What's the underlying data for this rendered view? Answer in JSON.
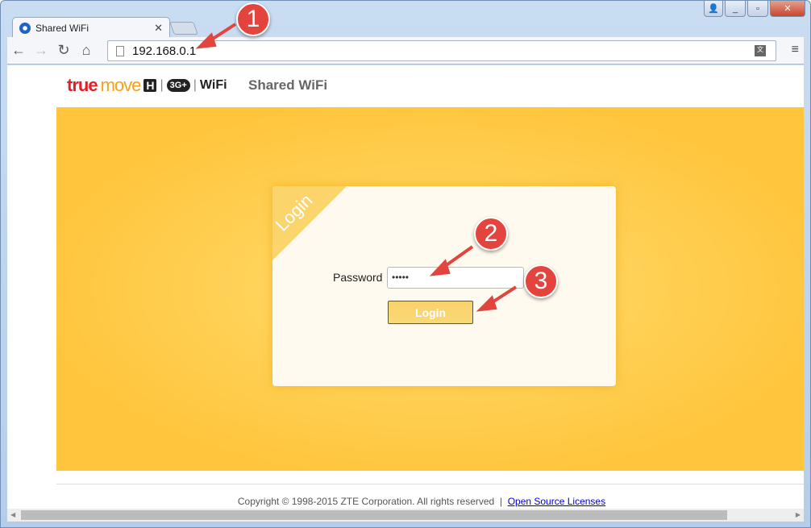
{
  "browser": {
    "tab_title": "Shared WiFi",
    "url": "192.168.0.1"
  },
  "header": {
    "logo_text": "truemove H 3G+ WiFi",
    "logo_true": "true",
    "logo_move": "move",
    "logo_h": "H",
    "logo_3g": "3G+",
    "logo_wifi": "WiFi",
    "title": "Shared WiFi"
  },
  "login": {
    "corner_label": "Login",
    "password_label": "Password",
    "password_value": "•••••",
    "button_label": "Login"
  },
  "footer": {
    "copyright": "Copyright © 1998-2015 ZTE Corporation. All rights reserved",
    "separator": "|",
    "link": "Open Source Licenses"
  },
  "annotations": [
    "1",
    "2",
    "3"
  ],
  "colors": {
    "banner": "#ffc53d",
    "annotation": "#e3443e",
    "brand_red": "#e21f26",
    "brand_orange": "#f7a11a"
  }
}
